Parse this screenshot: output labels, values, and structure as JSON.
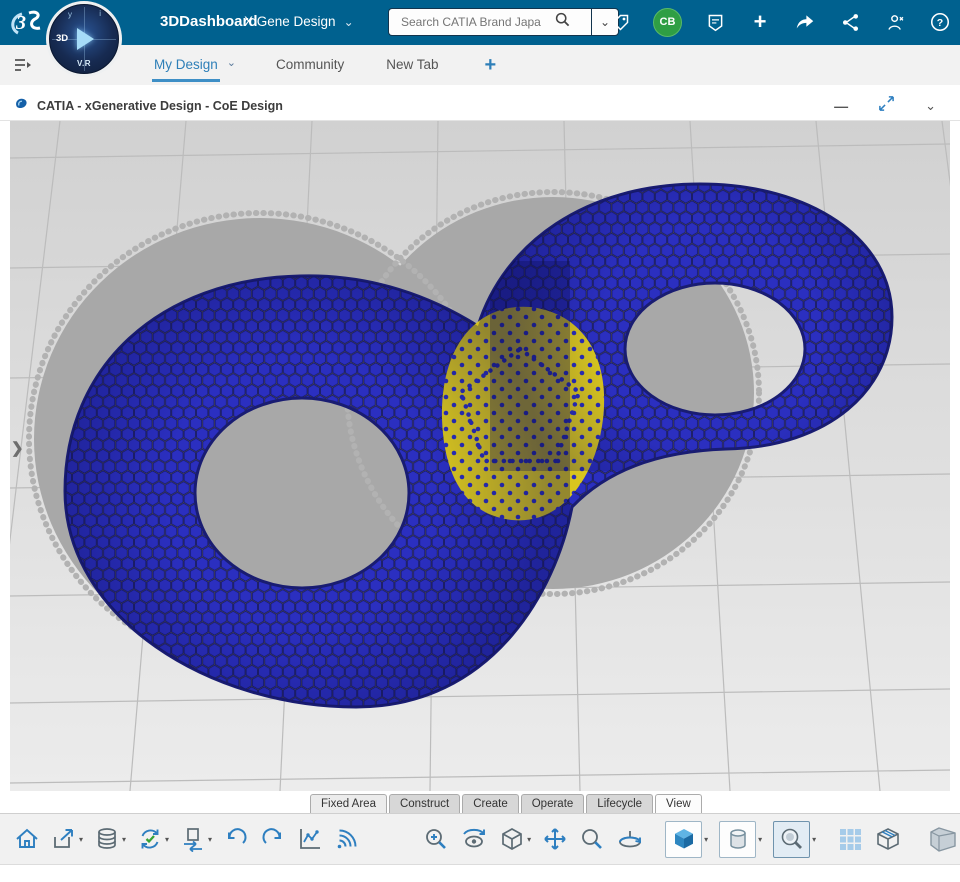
{
  "topbar": {
    "brand": "3DDashboard",
    "app_menu": "X Gene Design",
    "search": {
      "placeholder": "Search CATIA Brand Japa"
    },
    "avatar_initials": "CB",
    "icon_names": [
      "tag-icon",
      "avatar",
      "badge-icon",
      "add-icon",
      "share-icon",
      "network-icon",
      "assistant-icon",
      "help-icon"
    ]
  },
  "compass": {
    "top": "3D",
    "bottom": "V.R"
  },
  "nav": {
    "tabs": [
      {
        "label": "My Design",
        "active": true
      },
      {
        "label": "Community",
        "active": false
      },
      {
        "label": "New Tab",
        "active": false
      }
    ],
    "add_tab": "+"
  },
  "window": {
    "title": "CATIA - xGenerative Design - CoE Design"
  },
  "subtabs": [
    {
      "label": "Fixed Area",
      "active": false
    },
    {
      "label": "Construct",
      "active": false
    },
    {
      "label": "Create",
      "active": false
    },
    {
      "label": "Operate",
      "active": false
    },
    {
      "label": "Lifecycle",
      "active": false
    },
    {
      "label": "View",
      "active": true
    }
  ],
  "toolbar": {
    "left": [
      "home",
      "save-export",
      "database",
      "sync",
      "exchange",
      "undo",
      "redo",
      "analyze",
      "signal"
    ],
    "middle": [
      "zoom-area",
      "examine",
      "view-cube",
      "pan",
      "zoom",
      "turntable"
    ],
    "right": [
      "iso-view",
      "cylinder-style",
      "magnifier",
      "grid",
      "clipping",
      "extra"
    ]
  },
  "glyphs": {
    "chevron_down": "⌄",
    "caret": "▾",
    "expander": "❯",
    "minimize": "—",
    "plus": "+",
    "help": "?"
  },
  "colors": {
    "topbar": "#00618f",
    "accent_blue": "#2e7fc0",
    "avatar_green": "#2f9e44",
    "object_blue": "#2b2fc0",
    "object_yellow": "#d8c51e",
    "shadow_gray": "#a8a8a8"
  }
}
